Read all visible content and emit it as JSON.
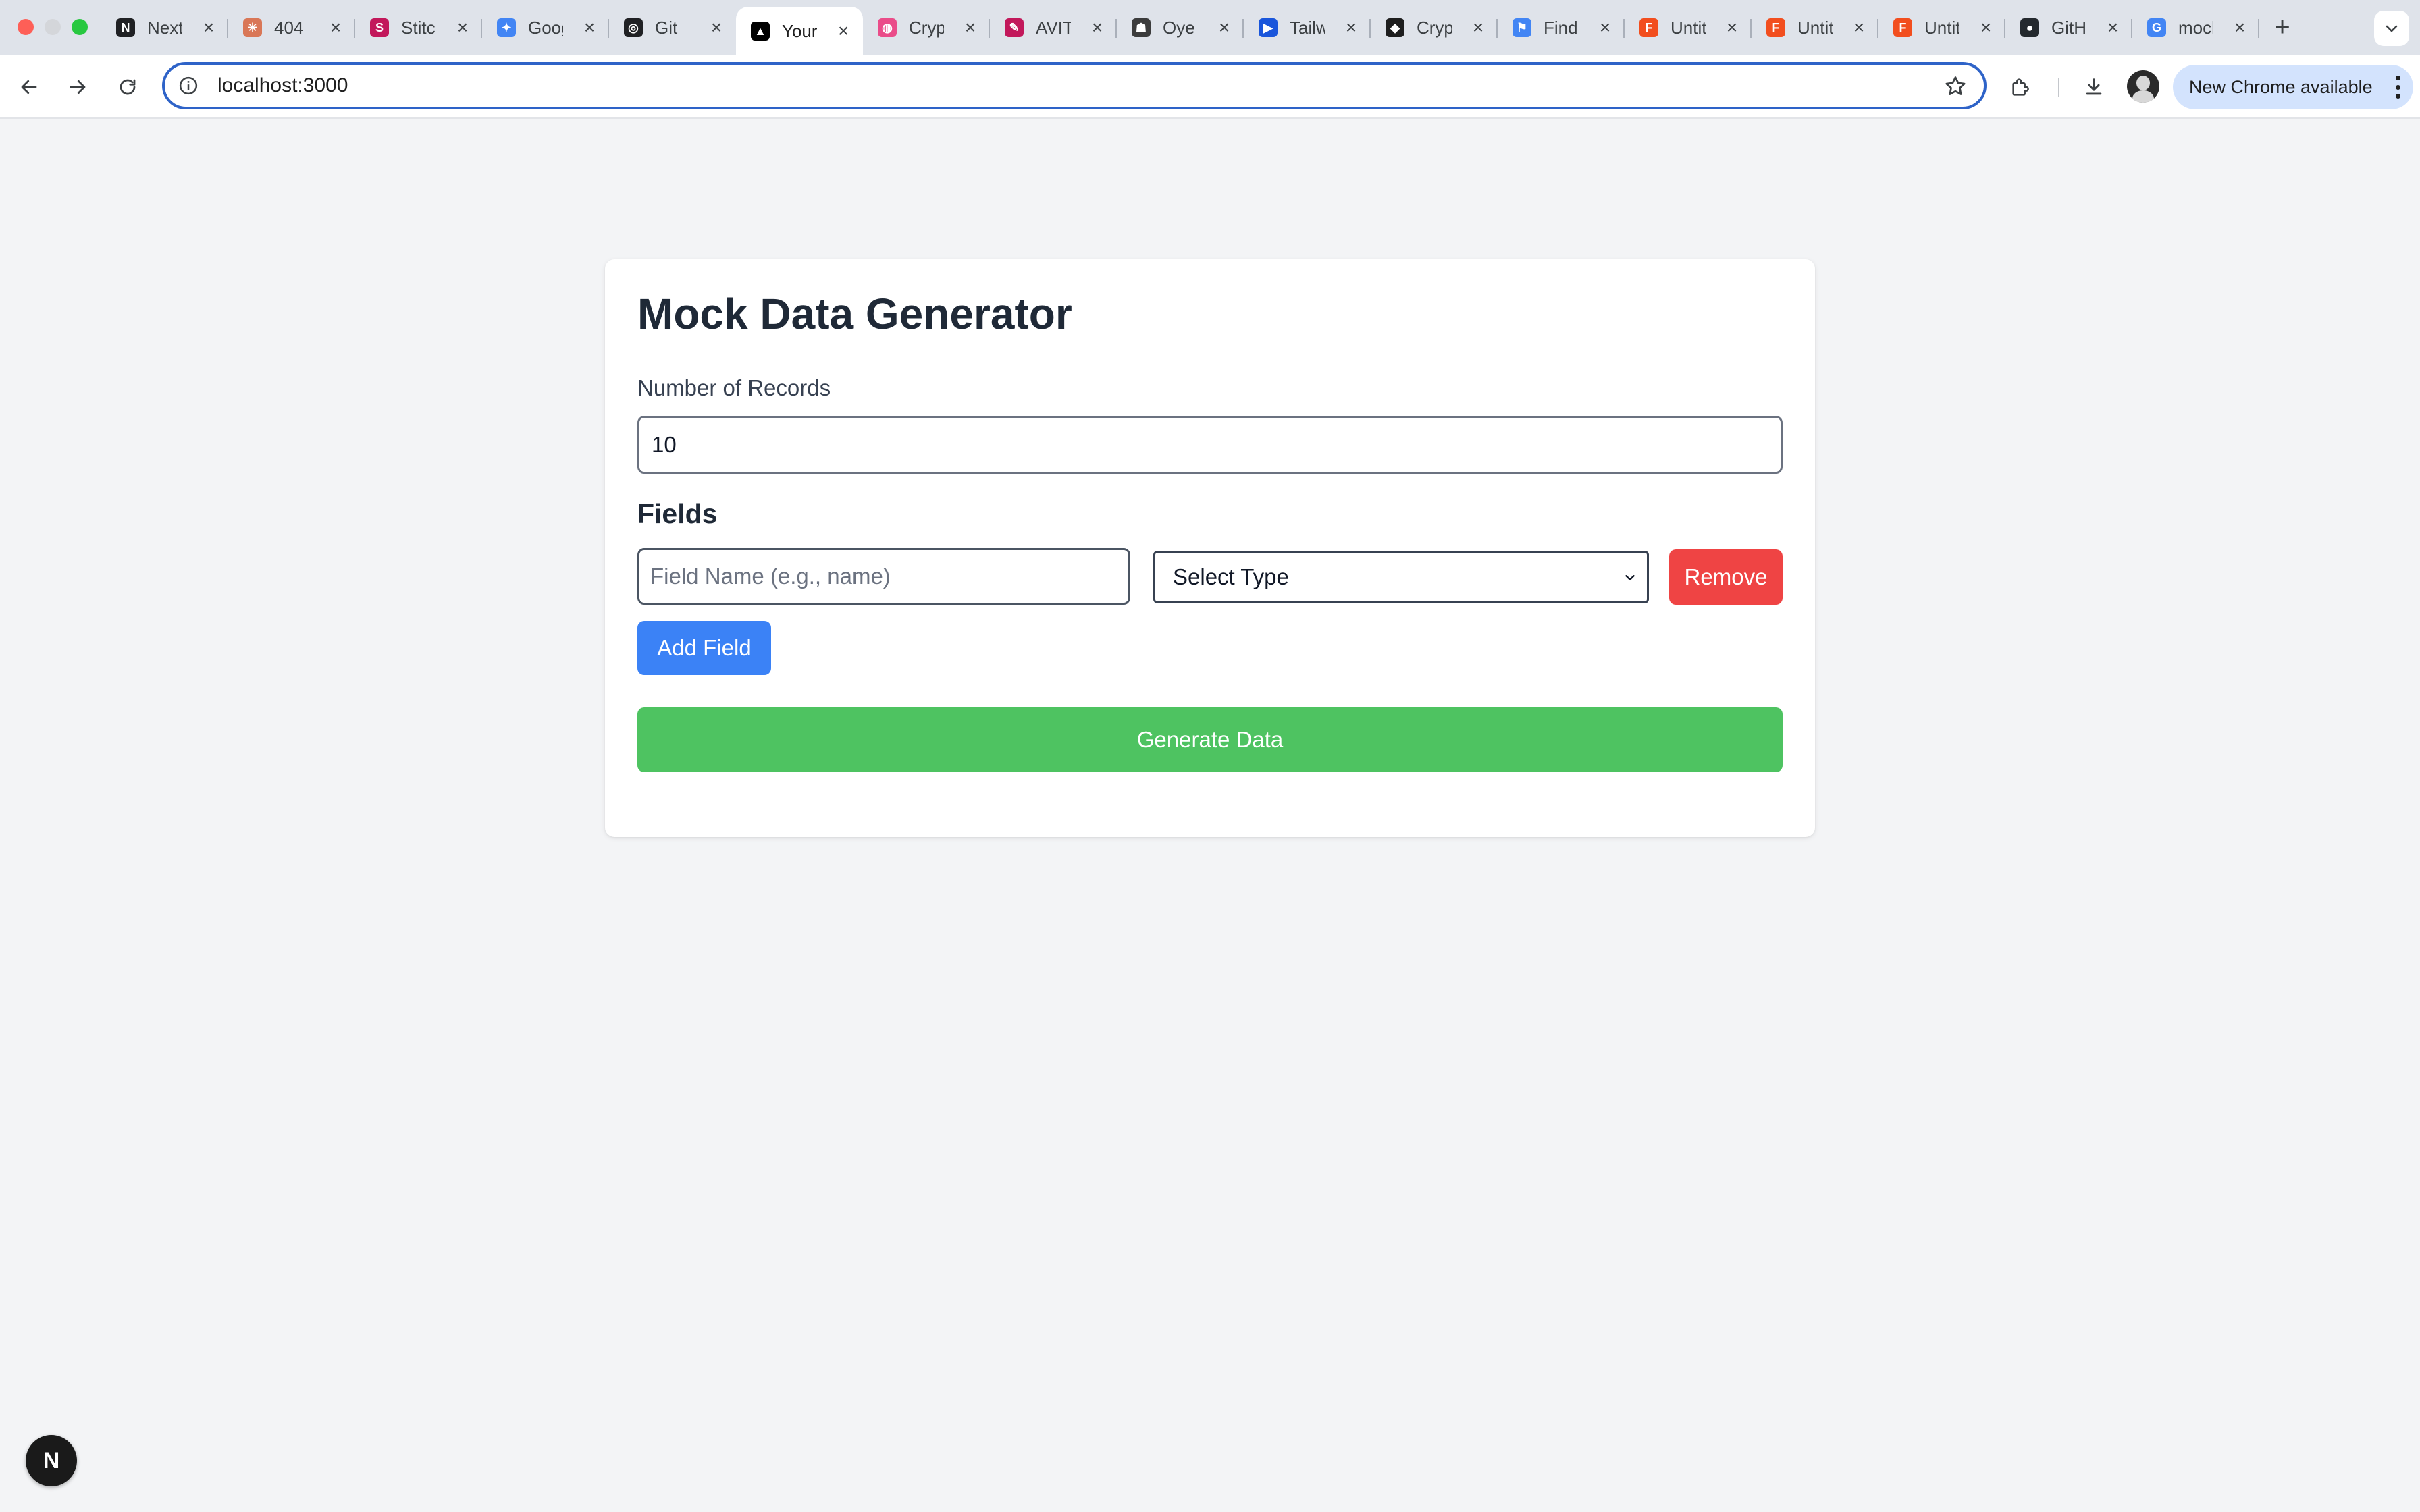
{
  "browser": {
    "tabs": [
      {
        "title": "Next",
        "icon": "nextjs-icon",
        "color": "#202124",
        "glyph": "N"
      },
      {
        "title": "404",
        "icon": "claude-icon",
        "color": "#d97757",
        "glyph": "✳"
      },
      {
        "title": "Stitch",
        "icon": "stitch-icon",
        "color": "#c2185b",
        "glyph": "S"
      },
      {
        "title": "Google",
        "icon": "gemini-icon",
        "color": "#4285f4",
        "glyph": "✦"
      },
      {
        "title": "Git",
        "icon": "openai-icon",
        "color": "#202124",
        "glyph": "◎"
      },
      {
        "title": "Your",
        "icon": "vercel-icon",
        "color": "#000000",
        "glyph": "▲",
        "active": true
      },
      {
        "title": "Crypto",
        "icon": "dribbble-icon",
        "color": "#ea4c89",
        "glyph": "◍"
      },
      {
        "title": "AVIT",
        "icon": "avit-icon",
        "color": "#c2185b",
        "glyph": "✎"
      },
      {
        "title": "Oye",
        "icon": "oye-icon",
        "color": "#3c3c3c",
        "glyph": "☗"
      },
      {
        "title": "Tailwind",
        "icon": "tailwind-icon",
        "color": "#1a56db",
        "glyph": "▶"
      },
      {
        "title": "Crypto",
        "icon": "binance-icon",
        "color": "#1e1e1e",
        "glyph": "◆"
      },
      {
        "title": "Find",
        "icon": "flag-icon",
        "color": "#4285f4",
        "glyph": "⚑"
      },
      {
        "title": "Untitled",
        "icon": "figma-icon",
        "color": "#f24e1e",
        "glyph": "F"
      },
      {
        "title": "Untitled",
        "icon": "figma-icon",
        "color": "#f24e1e",
        "glyph": "F"
      },
      {
        "title": "Untitled",
        "icon": "figma-icon",
        "color": "#f24e1e",
        "glyph": "F"
      },
      {
        "title": "GitHub",
        "icon": "github-icon",
        "color": "#24292e",
        "glyph": "●"
      },
      {
        "title": "mock",
        "icon": "google-icon",
        "color": "#4285f4",
        "glyph": "G"
      }
    ],
    "url": "localhost:3000",
    "update_label": "New Chrome available"
  },
  "page": {
    "title": "Mock Data Generator",
    "records_label": "Number of Records",
    "records_value": "10",
    "fields_heading": "Fields",
    "field_name_placeholder": "Field Name (e.g., name)",
    "type_select_value": "Select Type",
    "remove_label": "Remove",
    "add_field_label": "Add Field",
    "generate_label": "Generate Data",
    "colors": {
      "remove": "#ef4444",
      "add": "#3b82f6",
      "generate": "#4ec361"
    }
  },
  "nextjs_badge": "N"
}
